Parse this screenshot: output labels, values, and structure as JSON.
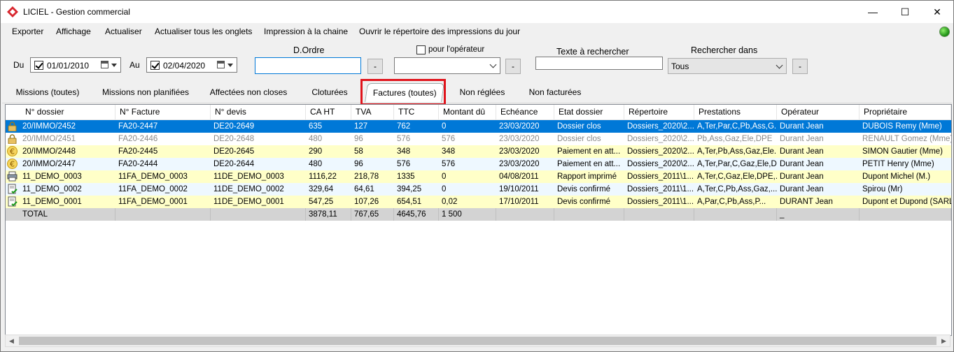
{
  "window": {
    "title": "LICIEL - Gestion commercial",
    "minimize": "—",
    "maximize": "☐",
    "close": "✕"
  },
  "menu": [
    "Exporter",
    "Affichage",
    "Actualiser",
    "Actualiser tous les onglets",
    "Impression à la chaine",
    "Ouvrir le répertoire des impressions du jour"
  ],
  "filters": {
    "du_label": "Du",
    "du_value": "01/01/2010",
    "au_label": "Au",
    "au_value": "02/04/2020",
    "dordre_label": "D.Ordre",
    "dordre_value": "",
    "minus": "-",
    "operateur_label": "pour l'opérateur",
    "operateur_value": "",
    "texte_label": "Texte à rechercher",
    "texte_value": "",
    "rechercher_label": "Rechercher dans",
    "rechercher_value": "Tous"
  },
  "tabs": [
    "Missions (toutes)",
    "Missions non planifiées",
    "Affectées non closes",
    "Cloturées",
    "Factures (toutes)",
    "Non réglées",
    "Non facturées"
  ],
  "active_tab": "Factures (toutes)",
  "columns": [
    "N° dossier",
    "N° Facture",
    "N° devis",
    "CA HT",
    "TVA",
    "TTC",
    "Montant dû",
    "Echéance",
    "Etat dossier",
    "Répertoire",
    "Prestations",
    "Opérateur",
    "Propriétaire"
  ],
  "rows": [
    {
      "icon": "lock-icon",
      "style": "selected",
      "cells": [
        "20/IMMO/2452",
        "FA20-2447",
        "DE20-2649",
        "635",
        "127",
        "762",
        "0",
        "23/03/2020",
        "Dossier clos",
        "Dossiers_2020\\2...",
        "A,Ter,Par,C,Pb,Ass,G...",
        "Durant Jean",
        "DUBOIS Remy (Mme)"
      ]
    },
    {
      "icon": "lock-icon",
      "style": "grey",
      "cells": [
        "20/IMMO/2451",
        "FA20-2446",
        "DE20-2648",
        "480",
        "96",
        "576",
        "576",
        "23/03/2020",
        "Dossier clos",
        "Dossiers_2020\\2...",
        "Pb,Ass,Gaz,Ele,DPE",
        "Durant Jean",
        "RENAULT Gomez (Mme)"
      ]
    },
    {
      "icon": "euro-icon",
      "style": "yellow",
      "cells": [
        "20/IMMO/2448",
        "FA20-2445",
        "DE20-2645",
        "290",
        "58",
        "348",
        "348",
        "23/03/2020",
        "Paiement en att...",
        "Dossiers_2020\\2...",
        "A,Ter,Pb,Ass,Gaz,Ele...",
        "Durant Jean",
        "SIMON Gautier (Mme)"
      ]
    },
    {
      "icon": "euro-icon",
      "style": "blue",
      "cells": [
        "20/IMMO/2447",
        "FA20-2444",
        "DE20-2644",
        "480",
        "96",
        "576",
        "576",
        "23/03/2020",
        "Paiement en att...",
        "Dossiers_2020\\2...",
        "A,Ter,Par,C,Gaz,Ele,DPE,...",
        "Durant Jean",
        "PETIT Henry (Mme)"
      ]
    },
    {
      "icon": "printer-icon",
      "style": "yellow",
      "cells": [
        "11_DEMO_0003",
        "11FA_DEMO_0003",
        "11DE_DEMO_0003",
        "1116,22",
        "218,78",
        "1335",
        "0",
        "04/08/2011",
        "Rapport imprimé",
        "Dossiers_2011\\1...",
        "A,Ter,C,Gaz,Ele,DPE,...",
        "Durant Jean",
        "Dupont Michel (M.)"
      ]
    },
    {
      "icon": "document-check-icon",
      "style": "blue",
      "cells": [
        "11_DEMO_0002",
        "11FA_DEMO_0002",
        "11DE_DEMO_0002",
        "329,64",
        "64,61",
        "394,25",
        "0",
        "19/10/2011",
        "Devis confirmé",
        "Dossiers_2011\\1...",
        "A,Ter,C,Pb,Ass,Gaz,...",
        "Durant Jean",
        "Spirou (Mr)"
      ]
    },
    {
      "icon": "document-check-icon",
      "style": "yellow",
      "cells": [
        "11_DEMO_0001",
        "11FA_DEMO_0001",
        "11DE_DEMO_0001",
        "547,25",
        "107,26",
        "654,51",
        "0,02",
        "17/10/2011",
        "Devis confirmé",
        "Dossiers_2011\\1...",
        "A,Par,C,Pb,Ass,P...",
        "DURANT Jean",
        "Dupont et Dupond (SARL)"
      ]
    }
  ],
  "total_row": [
    "TOTAL",
    "",
    "",
    "3878,11",
    "767,65",
    "4645,76",
    "1 500",
    "",
    "",
    "",
    "",
    "_",
    ""
  ],
  "colors": {
    "selected": "#0078d7",
    "yellow": "#ffffc8",
    "blue": "#eef8ff",
    "total": "#d3d3d3",
    "highlight": "#e0141c"
  }
}
